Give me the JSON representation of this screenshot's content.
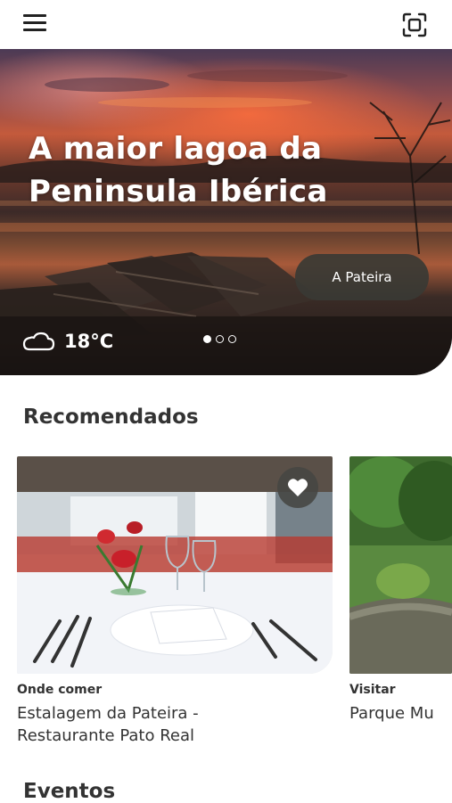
{
  "topbar": {
    "menu_icon": "hamburger-menu-icon",
    "scan_icon": "qr-scan-icon"
  },
  "hero": {
    "title_line1": "A maior lagoa da",
    "title_line2": "Peninsula Ibérica",
    "button_label": "A Pateira",
    "weather_icon": "cloud-icon",
    "temperature": "18°C",
    "slides_total": 3,
    "slide_active": 1
  },
  "recommended": {
    "title": "Recomendados",
    "cards": [
      {
        "category": "Onde comer",
        "name_line1": "Estalagem da Pateira -",
        "name_line2": "Restaurante Pato Real",
        "favorite_icon": "heart-icon"
      },
      {
        "category": "Visitar",
        "name_line1": "Parque Mu"
      }
    ]
  },
  "events": {
    "title": "Eventos"
  }
}
